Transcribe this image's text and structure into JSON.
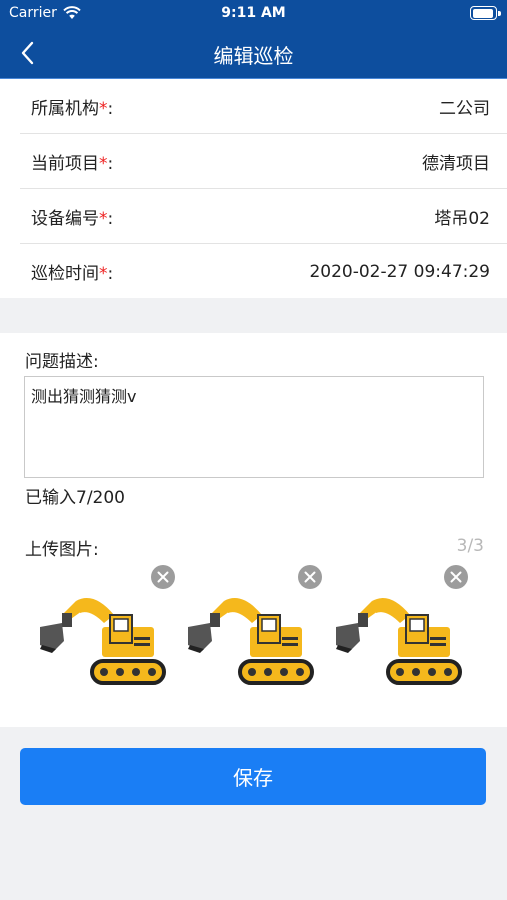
{
  "status_bar": {
    "carrier": "Carrier",
    "time": "9:11 AM"
  },
  "nav": {
    "title": "编辑巡检",
    "back_icon": "chevron-left-icon"
  },
  "info": {
    "rows": [
      {
        "label": "所属机构",
        "required": "*",
        "colon": ":",
        "value": "二公司"
      },
      {
        "label": "当前项目",
        "required": "*",
        "colon": ":",
        "value": "德清项目"
      },
      {
        "label": "设备编号",
        "required": "*",
        "colon": ":",
        "value": "塔吊02"
      },
      {
        "label": "巡检时间",
        "required": "*",
        "colon": ":",
        "value": "2020-02-27 09:47:29"
      }
    ]
  },
  "form": {
    "description_label": "问题描述:",
    "description_value": "测出猜测猜测v",
    "char_counter": "已输入7/200",
    "upload_label": "上传图片:",
    "upload_count": "3/3",
    "images": [
      {
        "icon": "excavator-image"
      },
      {
        "icon": "excavator-image"
      },
      {
        "icon": "excavator-image"
      }
    ]
  },
  "save_label": "保存",
  "colors": {
    "header_bg": "#0d4e9e",
    "primary_button": "#1a7ef5",
    "required_star": "#e22222",
    "page_bg": "#f0f1f3"
  }
}
